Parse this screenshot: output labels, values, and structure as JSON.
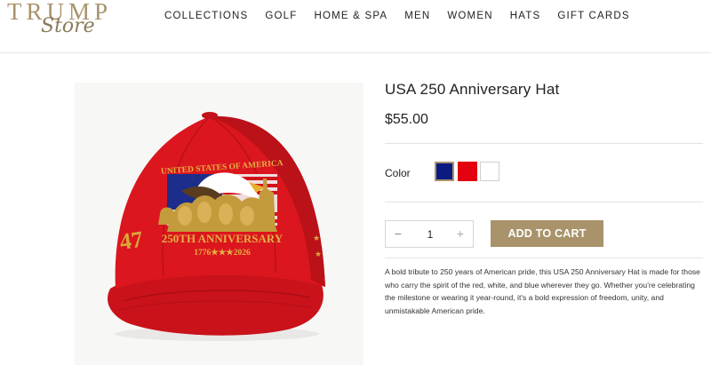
{
  "brand": {
    "logo_top": "TRUMP",
    "logo_bottom": "Store"
  },
  "nav": {
    "items": [
      {
        "label": "COLLECTIONS"
      },
      {
        "label": "GOLF"
      },
      {
        "label": "HOME & SPA"
      },
      {
        "label": "MEN"
      },
      {
        "label": "WOMEN"
      },
      {
        "label": "HATS"
      },
      {
        "label": "GIFT CARDS"
      }
    ]
  },
  "product": {
    "title": "USA 250 Anniversary Hat",
    "price": "$55.00",
    "color_label": "Color",
    "colors": [
      {
        "name": "navy",
        "hex": "#0b1b80",
        "selected": true
      },
      {
        "name": "red",
        "hex": "#e3000f",
        "selected": false
      },
      {
        "name": "white",
        "hex": "#ffffff",
        "selected": false
      }
    ],
    "quantity": {
      "minus": "−",
      "value": "1",
      "plus": "+"
    },
    "add_to_cart_label": "ADD TO CART",
    "description": "A bold tribute to 250 years of American pride, this USA 250 Anniversary Hat is made for those who carry the spirit of the red, white, and blue wherever they go. Whether you're celebrating the milestone or wearing it year-round, it's a bold expression of freedom, unity, and unmistakable American pride."
  },
  "hat_image": {
    "embroidery_top": "UNITED STATES OF AMERICA",
    "embroidery_main": "250TH ANNIVERSARY",
    "embroidery_years": "1776★★★2026",
    "hat_color": "#d8141c",
    "embroidery_color": "#d9a93a"
  }
}
